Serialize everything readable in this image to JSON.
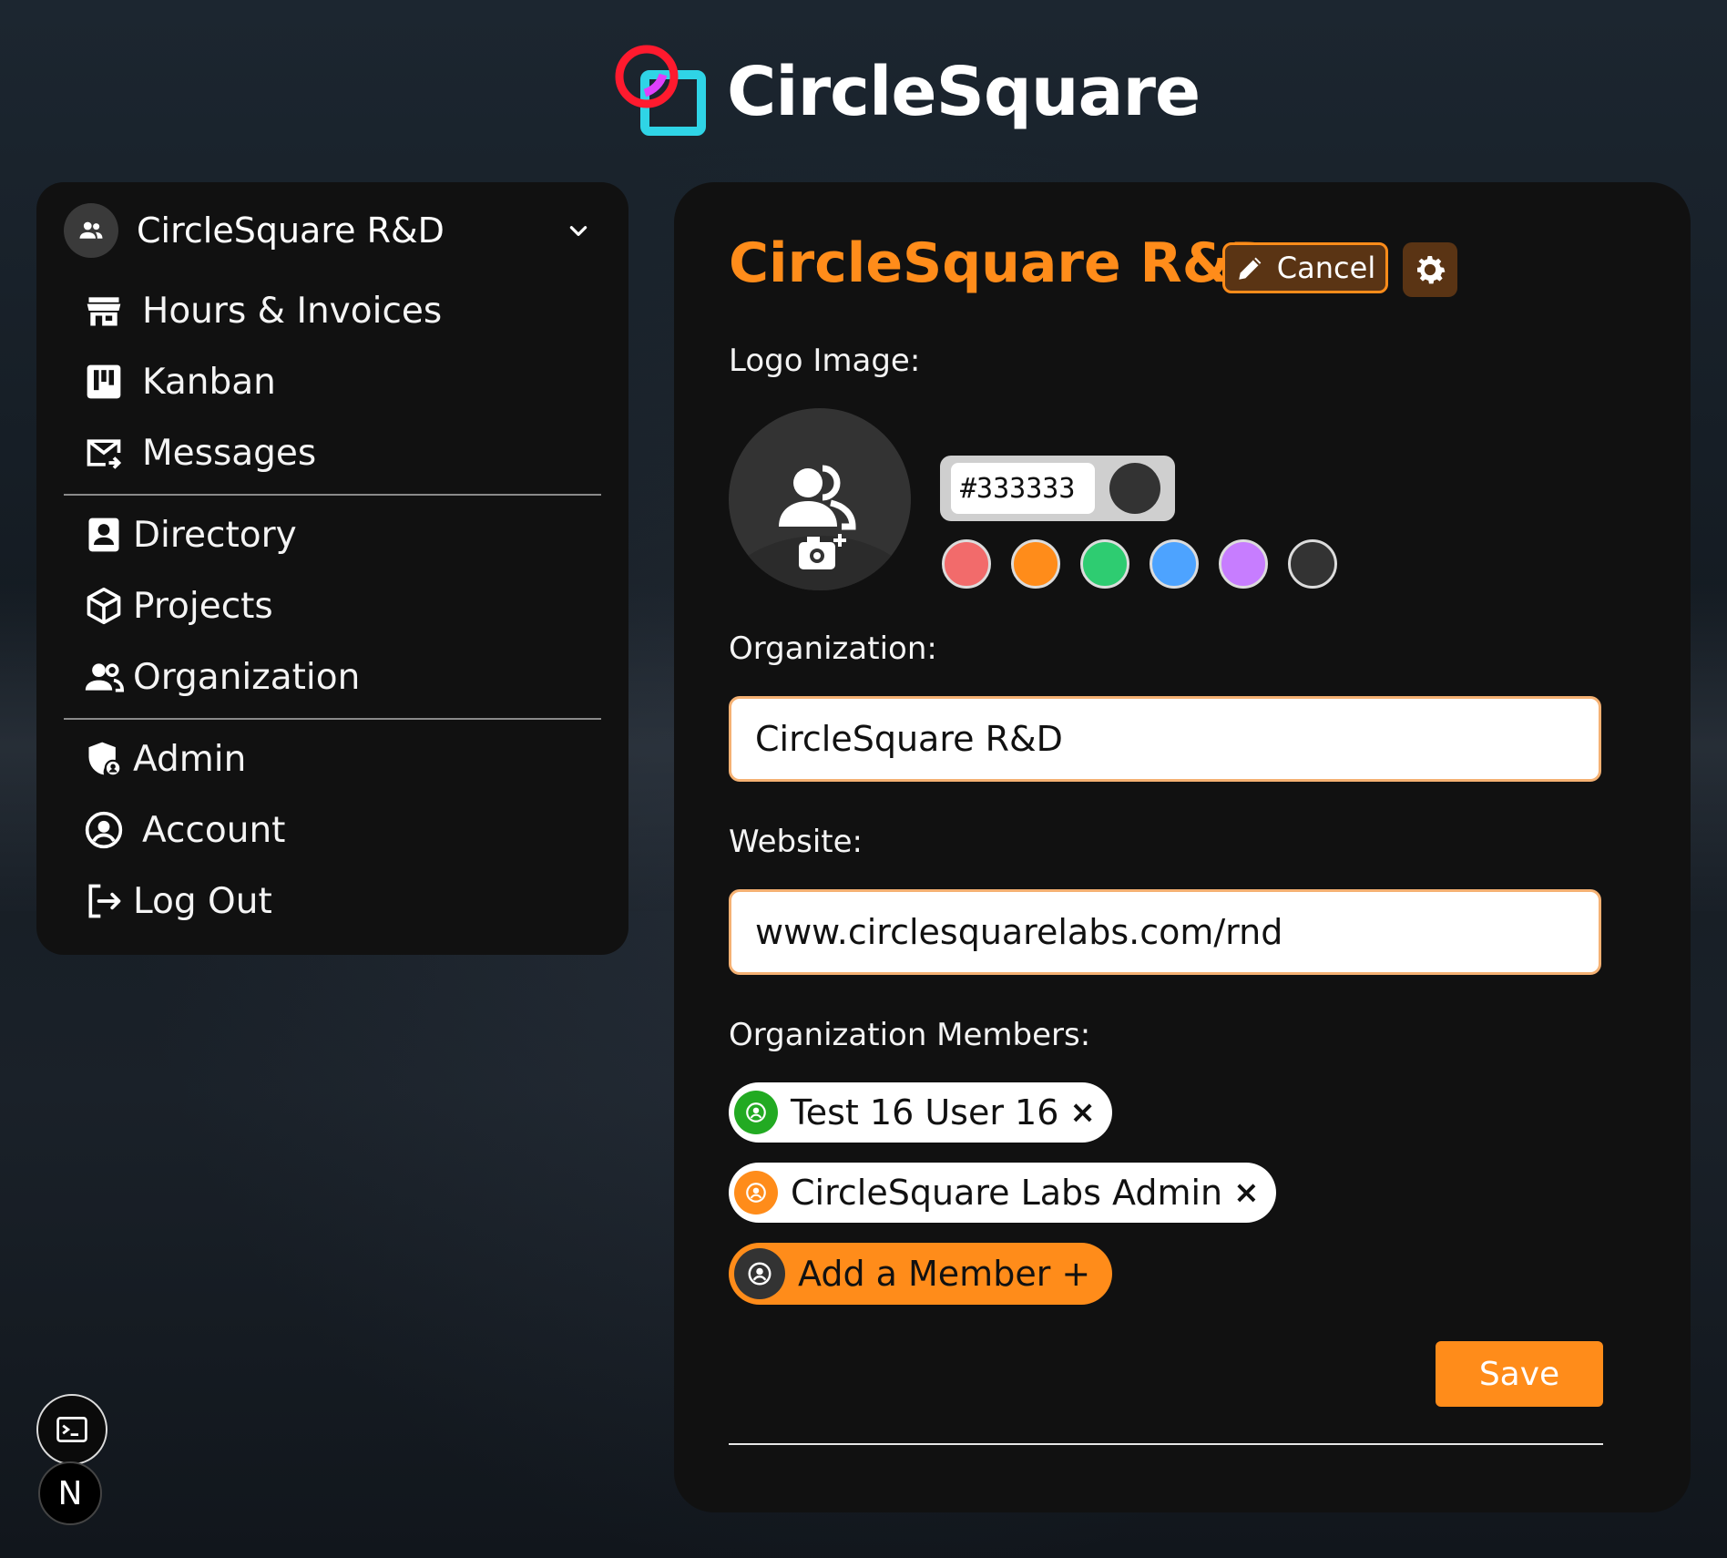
{
  "brand": {
    "name": "CircleSquare",
    "logo_icon": "circle-square-logo"
  },
  "sidebar": {
    "org_switcher": {
      "name": "CircleSquare R&D",
      "icon": "group-icon",
      "chevron": "chevron-down-icon"
    },
    "groups": [
      [
        {
          "label": "Hours & Invoices",
          "icon": "store-icon"
        },
        {
          "label": "Kanban",
          "icon": "kanban-icon"
        },
        {
          "label": "Messages",
          "icon": "mail-arrow-icon"
        }
      ],
      [
        {
          "label": "Directory",
          "icon": "contact-book-icon"
        },
        {
          "label": "Projects",
          "icon": "cube-icon"
        },
        {
          "label": "Organization",
          "icon": "people-icon"
        }
      ],
      [
        {
          "label": "Admin",
          "icon": "shield-user-icon"
        },
        {
          "label": "Account",
          "icon": "user-circle-icon"
        },
        {
          "label": "Log Out",
          "icon": "logout-icon"
        }
      ]
    ]
  },
  "main": {
    "title": "CircleSquare R&D",
    "cancel_label": "Cancel",
    "logo_label": "Logo Image:",
    "color_hex": "#333333",
    "swatches": [
      {
        "name": "red",
        "color": "#f26b6b"
      },
      {
        "name": "orange",
        "color": "#ff8c1a"
      },
      {
        "name": "green",
        "color": "#2ecc71"
      },
      {
        "name": "blue",
        "color": "#4da3ff"
      },
      {
        "name": "purple",
        "color": "#c77dff"
      },
      {
        "name": "dark",
        "color": "#333333"
      }
    ],
    "organization_label": "Organization:",
    "organization_value": "CircleSquare R&D",
    "website_label": "Website:",
    "website_value": "www.circlesquarelabs.com/rnd",
    "members_label": "Organization Members:",
    "members": [
      {
        "name": "Test 16 User 16",
        "color": "#22aa22"
      },
      {
        "name": "CircleSquare Labs Admin",
        "color": "#ff8c1a"
      }
    ],
    "remove_symbol": "×",
    "add_member_label": "Add a Member +",
    "save_label": "Save"
  },
  "dev": {
    "n_badge": "N"
  },
  "colors": {
    "accent": "#ff8c1a",
    "panel": "#111111",
    "background": "#161e26"
  }
}
